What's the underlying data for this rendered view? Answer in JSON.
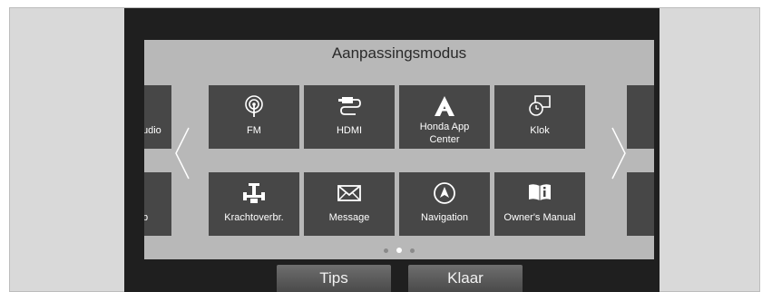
{
  "header": {
    "title": "Aanpassingsmodus"
  },
  "tiles_row1": [
    {
      "label": "FM",
      "icon": "fm-radio-icon"
    },
    {
      "label": "HDMI",
      "icon": "hdmi-icon"
    },
    {
      "label_line1": "Honda App",
      "label_line2": "Center",
      "icon": "honda-app-center-icon"
    },
    {
      "label": "Klok",
      "icon": "clock-icon"
    }
  ],
  "tiles_row2": [
    {
      "label": "Krachtoverbr.",
      "icon": "power-transfer-icon"
    },
    {
      "label": "Message",
      "icon": "envelope-icon"
    },
    {
      "label": "Navigation",
      "icon": "navigation-icon"
    },
    {
      "label": "Owner's Manual",
      "icon": "manual-book-icon"
    }
  ],
  "partial_tiles": {
    "left_row1_label": "udio",
    "left_row2_label": "b"
  },
  "pager": {
    "pages": 3,
    "active_index": 1
  },
  "buttons": {
    "tips_label": "Tips",
    "done_label": "Klaar"
  }
}
